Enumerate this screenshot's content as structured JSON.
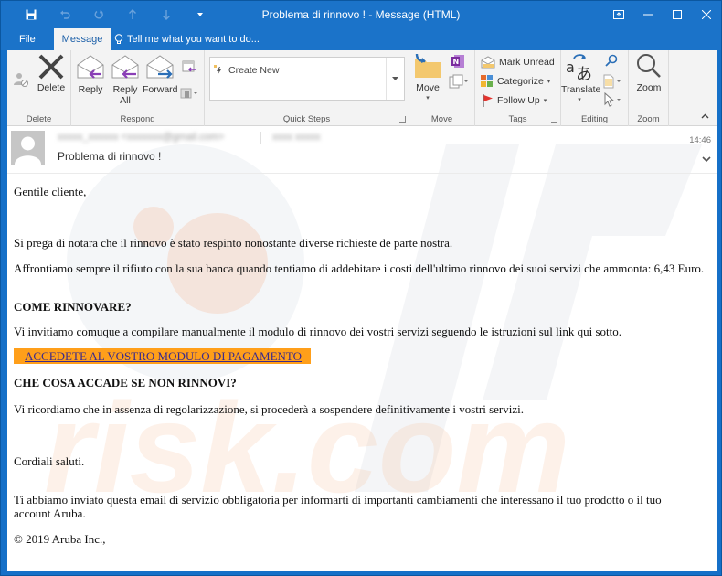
{
  "window": {
    "title": "Problema di rinnovo ! - Message (HTML)",
    "controls": [
      "ribbon-display-options",
      "minimize",
      "maximize",
      "close"
    ]
  },
  "qat": {
    "icons": [
      "save-icon",
      "undo-icon",
      "redo-icon",
      "previous-item-icon",
      "next-item-icon",
      "customize-qat-icon"
    ]
  },
  "tabs": {
    "file": "File",
    "message": "Message",
    "tell_me": "Tell me what you want to do..."
  },
  "ribbon": {
    "groups": {
      "delete": {
        "label": "Delete",
        "delete_button": "Delete"
      },
      "respond": {
        "label": "Respond",
        "reply": "Reply",
        "reply_all_line1": "Reply",
        "reply_all_line2": "All",
        "forward": "Forward"
      },
      "quick_steps": {
        "label": "Quick Steps",
        "items": [
          "Create New"
        ]
      },
      "move": {
        "label": "Move",
        "move_button": "Move"
      },
      "tags": {
        "label": "Tags",
        "mark_unread": "Mark Unread",
        "categorize": "Categorize",
        "follow_up": "Follow Up"
      },
      "editing": {
        "label": "Editing",
        "translate": "Translate"
      },
      "zoom": {
        "label": "Zoom",
        "zoom_button": "Zoom"
      }
    }
  },
  "message": {
    "sender": "xxxxx_xxxxxx <xxxxxxx@gmail.com>",
    "recipient": "xxxx xxxxx",
    "subject": "Problema di rinnovo !",
    "time": "14:46"
  },
  "body": {
    "greeting": "Gentile cliente,",
    "p1": "Si prega di notara che il rinnovo è stato respinto nonostante diverse richieste de parte nostra.",
    "p2": "Affrontiamo sempre il rifiuto con la sua banca quando tentiamo di addebitare i costi dell'ultimo rinnovo dei suoi servizi che ammonta: 6,43 Euro.",
    "h1": "COME RINNOVARE?",
    "p3": "Vi invitiamo comuque a compilare manualmente il modulo di rinnovo dei vostri servizi seguendo le istruzioni sul link qui sotto.",
    "cta": "ACCEDETE AL VOSTRO MODULO DI PAGAMENTO",
    "h2": "CHE COSA ACCADE SE NON RINNOVI?",
    "p4": "Vi ricordiamo che in assenza di regolarizzazione, si procederà a sospendere definitivamente i vostri servizi.",
    "closing": "Cordiali saluti.",
    "p5": "Ti abbiamo inviato questa email di servizio obbligatoria per informarti di importanti cambiamenti che interessano il tuo prodotto o il tuo account Aruba.",
    "copyright": "© 2019 Aruba Inc.,"
  },
  "colors": {
    "titlebar": "#1b73c9",
    "ribbon": "#f3f3f3",
    "cta_background": "#ff9f1a",
    "cta_link": "#3a2a8c"
  }
}
